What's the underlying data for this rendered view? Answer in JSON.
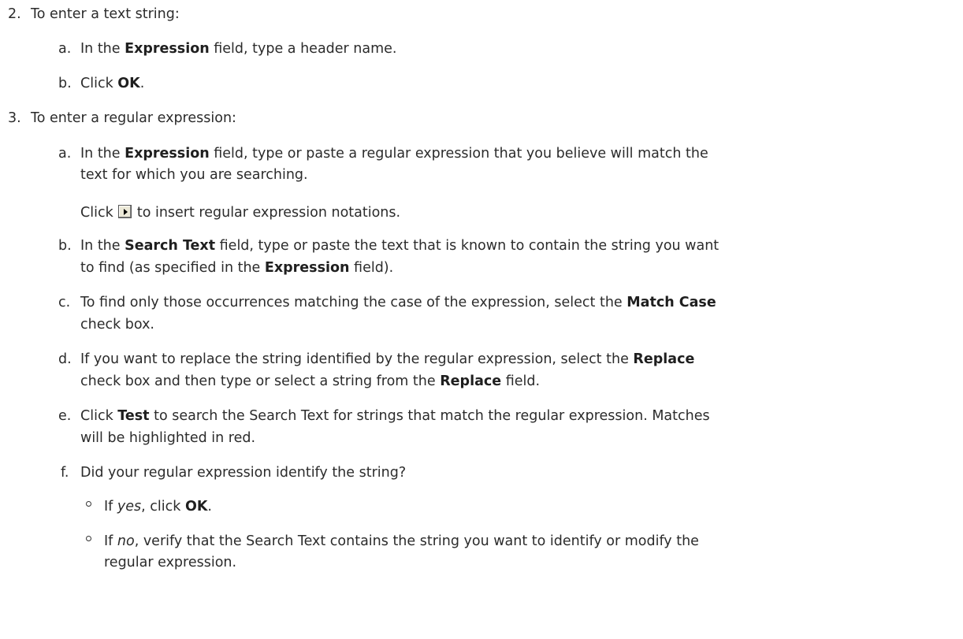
{
  "steps": {
    "s2": {
      "num": "2.",
      "intro": "To enter a text string:",
      "a": {
        "label": "a.",
        "t1": "In the ",
        "b1": "Expression",
        "t2": " field, type a header name."
      },
      "b": {
        "label": "b.",
        "t1": "Click ",
        "b1": "OK",
        "t2": "."
      }
    },
    "s3": {
      "num": "3.",
      "intro": "To enter a regular expression:",
      "a": {
        "label": "a.",
        "l1_t1": "In the ",
        "l1_b1": "Expression",
        "l1_t2": " field, type or paste a regular expression that you believe will match the",
        "l2": "text for which you are searching.",
        "note_t1": "Click ",
        "note_t2": " to insert regular expression notations."
      },
      "b": {
        "label": "b.",
        "l1_t1": "In the ",
        "l1_b1": "Search Text",
        "l1_t2": " field, type or paste the text that is known to contain the string you want",
        "l2_t1": "to find (as specified in the ",
        "l2_b1": "Expression",
        "l2_t2": " field)."
      },
      "c": {
        "label": "c.",
        "l1_t1": "To find only those occurrences matching the case of the expression, select the ",
        "l1_b1": "Match Case",
        "l2": "check box."
      },
      "d": {
        "label": "d.",
        "l1_t1": "If you want to replace the string identified by the regular expression, select the ",
        "l1_b1": "Replace",
        "l2_t1": "check box and then type or select a string from the ",
        "l2_b1": "Replace",
        "l2_t2": " field."
      },
      "e": {
        "label": "e.",
        "l1_t1": "Click ",
        "l1_b1": "Test",
        "l1_t2": " to search the Search Text for strings that match the regular expression. Matches",
        "l2": "will be highlighted in red."
      },
      "f": {
        "label": "f.",
        "intro": "Did your regular expression identify the string?",
        "yes_t1": "If ",
        "yes_i": "yes",
        "yes_t2": ", click ",
        "yes_b": "OK",
        "yes_t3": ".",
        "no_t1": "If ",
        "no_i": "no",
        "no_t2": ", verify that the Search Text contains the string you want to identify or modify the",
        "no_l2": "regular expression."
      }
    }
  },
  "icons": {
    "insert_notation": "arrow-right-button-icon"
  }
}
